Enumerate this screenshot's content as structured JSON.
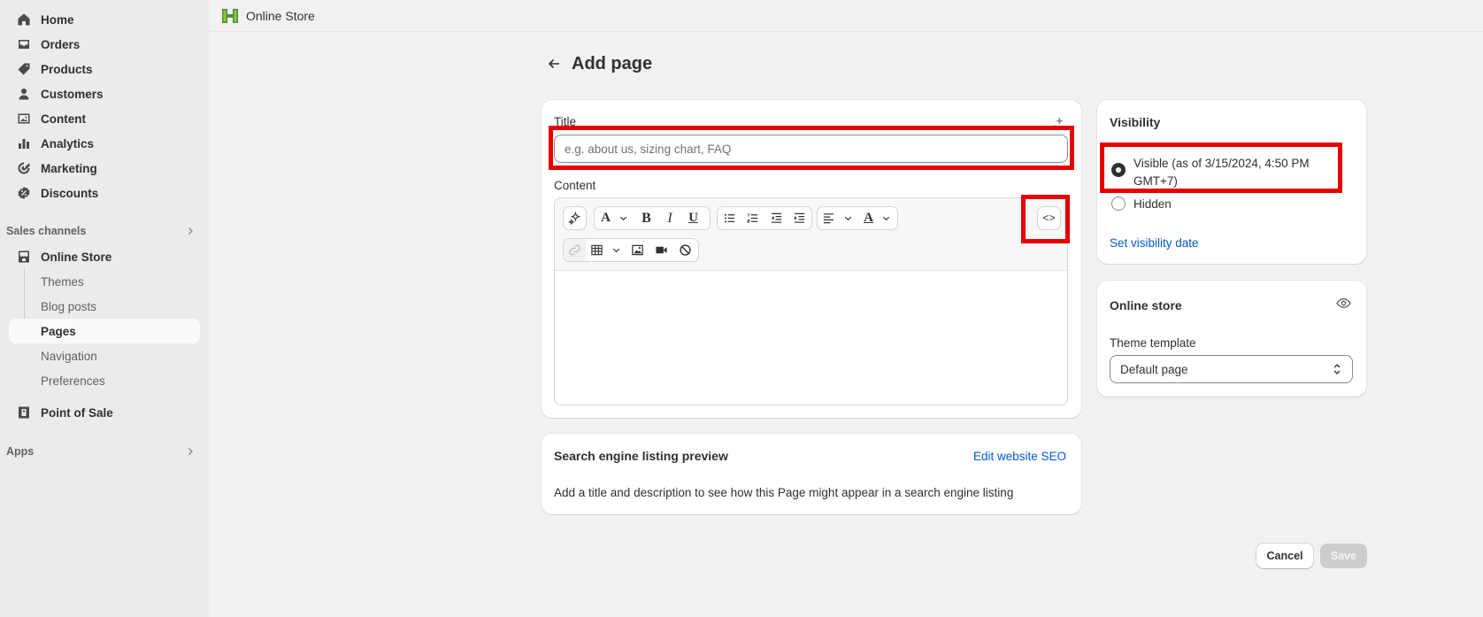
{
  "sidebar": {
    "main_items": [
      {
        "label": "Home",
        "icon": "home-icon"
      },
      {
        "label": "Orders",
        "icon": "inbox-icon"
      },
      {
        "label": "Products",
        "icon": "tag-icon"
      },
      {
        "label": "Customers",
        "icon": "person-icon"
      },
      {
        "label": "Content",
        "icon": "image-icon"
      },
      {
        "label": "Analytics",
        "icon": "bar-chart-icon"
      },
      {
        "label": "Marketing",
        "icon": "target-icon"
      },
      {
        "label": "Discounts",
        "icon": "discount-icon"
      }
    ],
    "sales_channels_label": "Sales channels",
    "online_store_label": "Online Store",
    "sub_items": [
      {
        "label": "Themes"
      },
      {
        "label": "Blog posts"
      },
      {
        "label": "Pages"
      },
      {
        "label": "Navigation"
      },
      {
        "label": "Preferences"
      }
    ],
    "pos_label": "Point of Sale",
    "apps_label": "Apps"
  },
  "topbar": {
    "store_name": "Online Store"
  },
  "page": {
    "title": "Add page"
  },
  "title_field": {
    "label": "Title",
    "placeholder": "e.g. about us, sizing chart, FAQ",
    "value": ""
  },
  "content_field": {
    "label": "Content",
    "show_html_label": "<>"
  },
  "toolbar": {
    "font_label": "A",
    "bold_label": "B",
    "italic_label": "I",
    "underline_label": "U",
    "color_label": "A"
  },
  "seo": {
    "title": "Search engine listing preview",
    "edit_link": "Edit website SEO",
    "description": "Add a title and description to see how this Page might appear in a search engine listing"
  },
  "visibility": {
    "title": "Visibility",
    "visible_label_line1": "Visible (as of 3/15/2024, 4:50 PM",
    "visible_label_line2": "GMT+7)",
    "hidden_label": "Hidden",
    "set_date_link": "Set visibility date",
    "selected": "visible"
  },
  "online_store_card": {
    "title": "Online store",
    "template_label": "Theme template",
    "template_value": "Default page"
  },
  "actions": {
    "cancel_label": "Cancel",
    "save_label": "Save"
  },
  "colors": {
    "highlight": "#e60000",
    "link": "#005bd3",
    "primary_disabled": "#cccccc"
  }
}
